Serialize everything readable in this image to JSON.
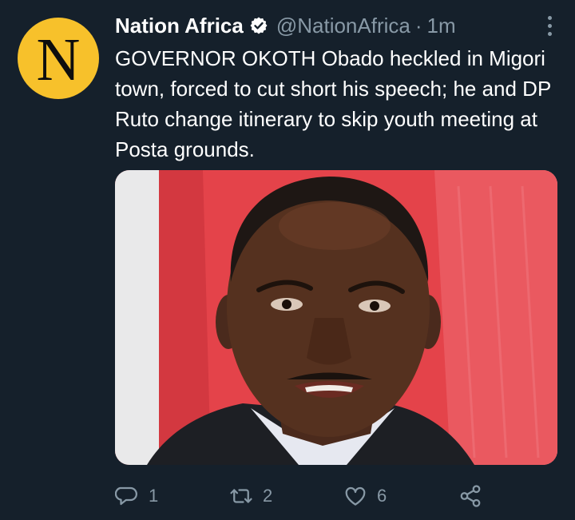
{
  "tweet": {
    "avatar_letter": "N",
    "author_name": "Nation Africa",
    "handle": "@NationAfrica",
    "separator": "·",
    "time": "1m",
    "text": "GOVERNOR OKOTH Obado heckled in Migori town, forced to cut short his speech; he and DP Ruto change itinerary to skip youth meeting at Posta grounds.",
    "icons": {
      "verified": "verified-badge-icon",
      "more": "more-options-icon",
      "reply": "reply-icon",
      "retweet": "retweet-icon",
      "like": "like-icon",
      "share": "share-icon"
    },
    "actions": {
      "reply_count": "1",
      "retweet_count": "2",
      "like_count": "6"
    }
  },
  "colors": {
    "background": "#15202b",
    "secondary_text": "#8899a6",
    "avatar_bg": "#f7c12b",
    "text": "#ffffff"
  }
}
